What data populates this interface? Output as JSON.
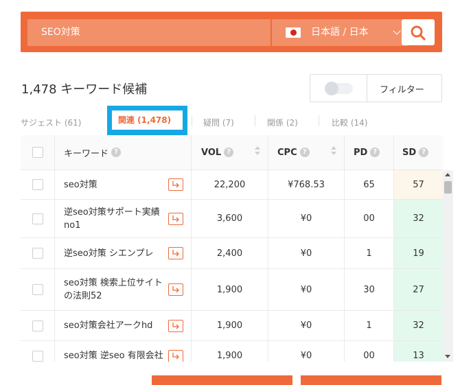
{
  "search": {
    "query": "SEO対策",
    "language": "日本語 / 日本"
  },
  "summary": {
    "title": "1,478 キーワード候補",
    "filter_label": "フィルター"
  },
  "tabs": [
    {
      "label": "サジェスト (61)"
    },
    {
      "label": "関連 (1,478)",
      "active": true
    },
    {
      "label": "疑問 (7)"
    },
    {
      "label": "関係 (2)"
    },
    {
      "label": "比較 (14)"
    }
  ],
  "table": {
    "headers": [
      "キーワード",
      "VOL",
      "CPC",
      "PD",
      "SD"
    ],
    "rows": [
      {
        "keyword": "seo対策",
        "vol": "22,200",
        "cpc": "¥768.53",
        "pd": "65",
        "sd": "57",
        "sd_color": "#fdf6ea"
      },
      {
        "keyword": "逆seo対策サポート実績no1",
        "vol": "3,600",
        "cpc": "¥0",
        "pd": "00",
        "sd": "32",
        "sd_color": "#e4f9ee"
      },
      {
        "keyword": "逆seo対策 シエンプレ",
        "vol": "2,400",
        "cpc": "¥0",
        "pd": "1",
        "sd": "19",
        "sd_color": "#e4f9ee"
      },
      {
        "keyword": "seo対策 検索上位サイトの法則52",
        "vol": "1,900",
        "cpc": "¥0",
        "pd": "30",
        "sd": "27",
        "sd_color": "#e4f9ee"
      },
      {
        "keyword": "seo対策会社アークhd",
        "vol": "1,900",
        "cpc": "¥0",
        "pd": "1",
        "sd": "32",
        "sd_color": "#e4f9ee"
      },
      {
        "keyword": "seo対策 逆seo 有限会社",
        "vol": "1,900",
        "cpc": "¥0",
        "pd": "00",
        "sd": "13",
        "sd_color": "#e4f9ee"
      }
    ]
  },
  "colors": {
    "accent": "#ef6a3a",
    "tab_highlight": "#17a8e4",
    "sd_easy": "#e4f9ee",
    "sd_medium": "#fdf6ea"
  }
}
